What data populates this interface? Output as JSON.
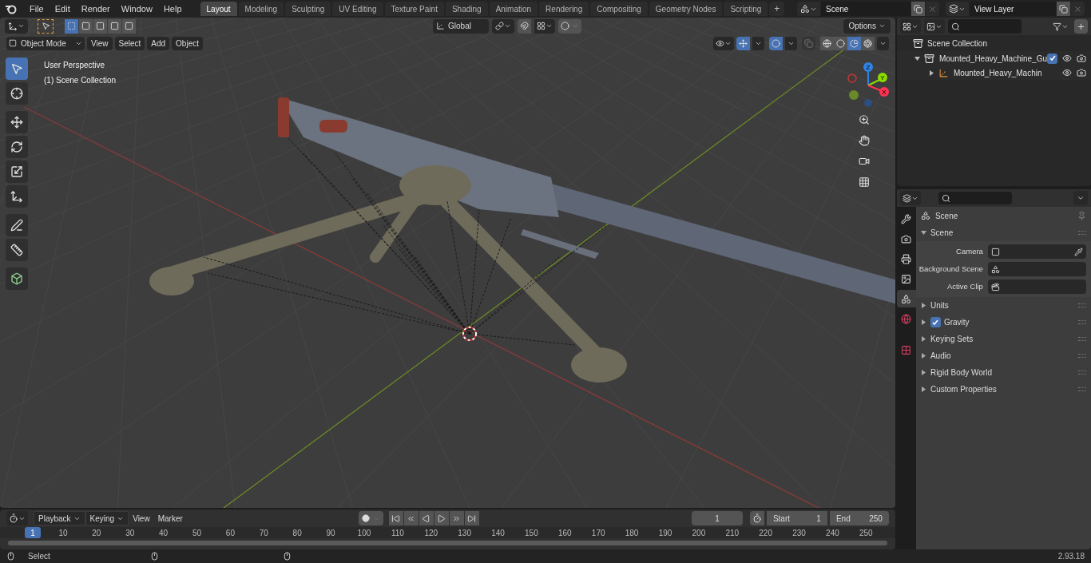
{
  "menu": [
    "File",
    "Edit",
    "Render",
    "Window",
    "Help"
  ],
  "workspaces": [
    {
      "label": "Layout",
      "selected": true
    },
    {
      "label": "Modeling",
      "selected": false
    },
    {
      "label": "Sculpting",
      "selected": false
    },
    {
      "label": "UV Editing",
      "selected": false
    },
    {
      "label": "Texture Paint",
      "selected": false
    },
    {
      "label": "Shading",
      "selected": false
    },
    {
      "label": "Animation",
      "selected": false
    },
    {
      "label": "Rendering",
      "selected": false
    },
    {
      "label": "Compositing",
      "selected": false
    },
    {
      "label": "Geometry Nodes",
      "selected": false
    },
    {
      "label": "Scripting",
      "selected": false
    }
  ],
  "add_tab": "+",
  "scene_field": {
    "value": "Scene"
  },
  "view_layer_field": {
    "value": "View Layer"
  },
  "viewport": {
    "select_modes": [
      {
        "kind": "new",
        "selected": true
      },
      {
        "kind": "extend",
        "selected": false
      },
      {
        "kind": "subtract",
        "selected": false
      },
      {
        "kind": "invert",
        "selected": false
      },
      {
        "kind": "intersect",
        "selected": false
      }
    ],
    "orientation": "Global",
    "options": "Options",
    "mode": "Object Mode",
    "menus": [
      "View",
      "Select",
      "Add",
      "Object"
    ],
    "shading": [
      {
        "kind": "wireframe",
        "selected": false
      },
      {
        "kind": "solid",
        "selected": false
      },
      {
        "kind": "material",
        "selected": true
      },
      {
        "kind": "rendered",
        "selected": false
      }
    ],
    "overlay_text": [
      "User Perspective",
      "(1) Scene Collection"
    ],
    "tools": [
      {
        "kind": "select",
        "selected": true
      },
      {
        "kind": "cursor",
        "selected": false
      },
      {
        "kind": "move",
        "selected": false
      },
      {
        "kind": "rotate",
        "selected": false
      },
      {
        "kind": "scale",
        "selected": false
      },
      {
        "kind": "transform",
        "selected": false
      },
      {
        "kind": "annotate",
        "selected": false
      },
      {
        "kind": "measure",
        "selected": false
      },
      {
        "kind": "add-cube",
        "selected": false
      }
    ],
    "gizmo": [
      {
        "label": "Z",
        "color": "#2f83e3"
      },
      {
        "label": "Y",
        "color": "#8bdc00"
      },
      {
        "label": "X",
        "color": "#ff3352"
      }
    ]
  },
  "outliner": {
    "root": "Scene Collection",
    "items": [
      {
        "label": "Mounted_Heavy_Machine_Gu",
        "kind": "collection",
        "expanded": true,
        "checked": true,
        "children": [
          {
            "label": "Mounted_Heavy_Machin",
            "kind": "empty",
            "expanded": false
          }
        ]
      }
    ]
  },
  "properties": {
    "tabs": [
      {
        "kind": "tool",
        "selected": false
      },
      {
        "kind": "render",
        "selected": false
      },
      {
        "kind": "output",
        "selected": false
      },
      {
        "kind": "view-layer",
        "selected": false
      },
      {
        "kind": "scene",
        "selected": true
      },
      {
        "kind": "world",
        "selected": false
      },
      {
        "kind": "texture",
        "selected": false
      }
    ],
    "title": "Scene",
    "panels": [
      {
        "label": "Scene",
        "expanded": true,
        "fields": [
          {
            "label": "Camera",
            "kind": "camera"
          },
          {
            "label": "Background Scene",
            "kind": "scene"
          },
          {
            "label": "Active Clip",
            "kind": "clip"
          }
        ]
      },
      {
        "label": "Units",
        "expanded": false
      },
      {
        "label": "Gravity",
        "expanded": false,
        "checked": true
      },
      {
        "label": "Keying Sets",
        "expanded": false
      },
      {
        "label": "Audio",
        "expanded": false
      },
      {
        "label": "Rigid Body World",
        "expanded": false
      },
      {
        "label": "Custom Properties",
        "expanded": false
      }
    ]
  },
  "timeline": {
    "menus": [
      {
        "label": "Playback",
        "dropdown": true
      },
      {
        "label": "Keying",
        "dropdown": true
      },
      {
        "label": "View",
        "dropdown": false
      },
      {
        "label": "Marker",
        "dropdown": false
      }
    ],
    "current_frame": "1",
    "start_label": "Start",
    "start": "1",
    "end_label": "End",
    "end": "250",
    "ruler_current": "1",
    "ticks": [
      "10",
      "20",
      "30",
      "40",
      "50",
      "60",
      "70",
      "80",
      "90",
      "100",
      "110",
      "120",
      "130",
      "140",
      "150",
      "160",
      "170",
      "180",
      "190",
      "200",
      "210",
      "220",
      "230",
      "240",
      "250"
    ]
  },
  "status_bar": {
    "hint": "Select",
    "version": "2.93.18"
  }
}
